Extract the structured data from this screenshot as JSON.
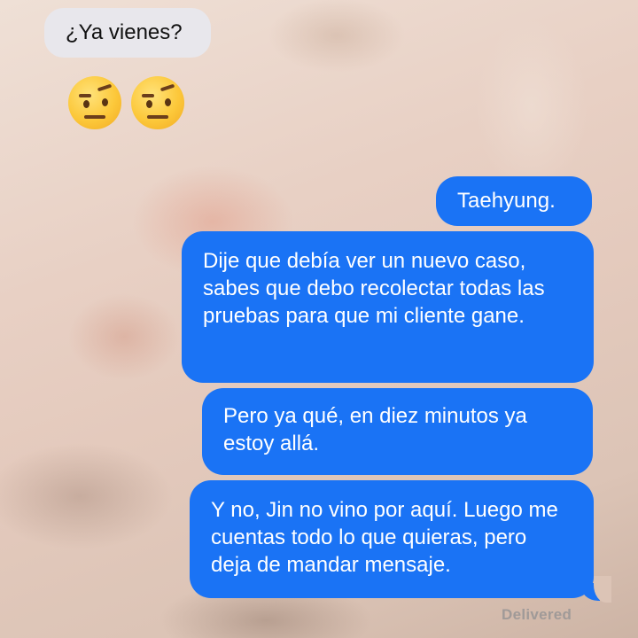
{
  "conversation": {
    "incoming_message": "¿Ya vienes?",
    "reaction_emojis": [
      "face-with-raised-eyebrow-icon",
      "face-with-raised-eyebrow-icon"
    ],
    "outgoing_messages": [
      "Taehyung.",
      "Dije que debía ver un nuevo caso, sabes que debo recolectar todas las pruebas para que mi cliente gane.",
      "Pero ya qué, en diez minutos ya estoy allá.",
      "Y no, Jin no vino por aquí. Luego me cuentas todo lo que quieras, pero deja de mandar mensaje."
    ],
    "delivery_status": "Delivered"
  },
  "colors": {
    "incoming_bubble": "#e8e7ec",
    "outgoing_bubble": "#1a73f5",
    "outgoing_text": "#ffffff",
    "status_text": "#a09a98"
  }
}
